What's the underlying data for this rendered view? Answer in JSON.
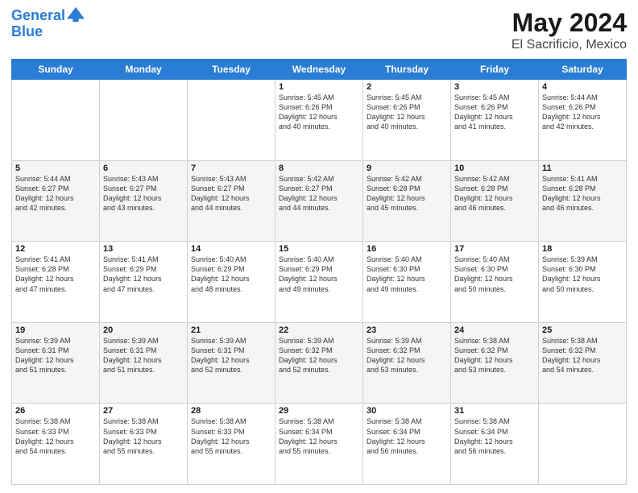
{
  "logo": {
    "line1": "General",
    "line2": "Blue"
  },
  "title": "May 2024",
  "subtitle": "El Sacrificio, Mexico",
  "days_of_week": [
    "Sunday",
    "Monday",
    "Tuesday",
    "Wednesday",
    "Thursday",
    "Friday",
    "Saturday"
  ],
  "weeks": [
    [
      {
        "day": "",
        "info": ""
      },
      {
        "day": "",
        "info": ""
      },
      {
        "day": "",
        "info": ""
      },
      {
        "day": "1",
        "info": "Sunrise: 5:45 AM\nSunset: 6:26 PM\nDaylight: 12 hours\nand 40 minutes."
      },
      {
        "day": "2",
        "info": "Sunrise: 5:45 AM\nSunset: 6:26 PM\nDaylight: 12 hours\nand 40 minutes."
      },
      {
        "day": "3",
        "info": "Sunrise: 5:45 AM\nSunset: 6:26 PM\nDaylight: 12 hours\nand 41 minutes."
      },
      {
        "day": "4",
        "info": "Sunrise: 5:44 AM\nSunset: 6:26 PM\nDaylight: 12 hours\nand 42 minutes."
      }
    ],
    [
      {
        "day": "5",
        "info": "Sunrise: 5:44 AM\nSunset: 6:27 PM\nDaylight: 12 hours\nand 42 minutes."
      },
      {
        "day": "6",
        "info": "Sunrise: 5:43 AM\nSunset: 6:27 PM\nDaylight: 12 hours\nand 43 minutes."
      },
      {
        "day": "7",
        "info": "Sunrise: 5:43 AM\nSunset: 6:27 PM\nDaylight: 12 hours\nand 44 minutes."
      },
      {
        "day": "8",
        "info": "Sunrise: 5:42 AM\nSunset: 6:27 PM\nDaylight: 12 hours\nand 44 minutes."
      },
      {
        "day": "9",
        "info": "Sunrise: 5:42 AM\nSunset: 6:28 PM\nDaylight: 12 hours\nand 45 minutes."
      },
      {
        "day": "10",
        "info": "Sunrise: 5:42 AM\nSunset: 6:28 PM\nDaylight: 12 hours\nand 46 minutes."
      },
      {
        "day": "11",
        "info": "Sunrise: 5:41 AM\nSunset: 6:28 PM\nDaylight: 12 hours\nand 46 minutes."
      }
    ],
    [
      {
        "day": "12",
        "info": "Sunrise: 5:41 AM\nSunset: 6:28 PM\nDaylight: 12 hours\nand 47 minutes."
      },
      {
        "day": "13",
        "info": "Sunrise: 5:41 AM\nSunset: 6:29 PM\nDaylight: 12 hours\nand 47 minutes."
      },
      {
        "day": "14",
        "info": "Sunrise: 5:40 AM\nSunset: 6:29 PM\nDaylight: 12 hours\nand 48 minutes."
      },
      {
        "day": "15",
        "info": "Sunrise: 5:40 AM\nSunset: 6:29 PM\nDaylight: 12 hours\nand 49 minutes."
      },
      {
        "day": "16",
        "info": "Sunrise: 5:40 AM\nSunset: 6:30 PM\nDaylight: 12 hours\nand 49 minutes."
      },
      {
        "day": "17",
        "info": "Sunrise: 5:40 AM\nSunset: 6:30 PM\nDaylight: 12 hours\nand 50 minutes."
      },
      {
        "day": "18",
        "info": "Sunrise: 5:39 AM\nSunset: 6:30 PM\nDaylight: 12 hours\nand 50 minutes."
      }
    ],
    [
      {
        "day": "19",
        "info": "Sunrise: 5:39 AM\nSunset: 6:31 PM\nDaylight: 12 hours\nand 51 minutes."
      },
      {
        "day": "20",
        "info": "Sunrise: 5:39 AM\nSunset: 6:31 PM\nDaylight: 12 hours\nand 51 minutes."
      },
      {
        "day": "21",
        "info": "Sunrise: 5:39 AM\nSunset: 6:31 PM\nDaylight: 12 hours\nand 52 minutes."
      },
      {
        "day": "22",
        "info": "Sunrise: 5:39 AM\nSunset: 6:32 PM\nDaylight: 12 hours\nand 52 minutes."
      },
      {
        "day": "23",
        "info": "Sunrise: 5:39 AM\nSunset: 6:32 PM\nDaylight: 12 hours\nand 53 minutes."
      },
      {
        "day": "24",
        "info": "Sunrise: 5:38 AM\nSunset: 6:32 PM\nDaylight: 12 hours\nand 53 minutes."
      },
      {
        "day": "25",
        "info": "Sunrise: 5:38 AM\nSunset: 6:32 PM\nDaylight: 12 hours\nand 54 minutes."
      }
    ],
    [
      {
        "day": "26",
        "info": "Sunrise: 5:38 AM\nSunset: 6:33 PM\nDaylight: 12 hours\nand 54 minutes."
      },
      {
        "day": "27",
        "info": "Sunrise: 5:38 AM\nSunset: 6:33 PM\nDaylight: 12 hours\nand 55 minutes."
      },
      {
        "day": "28",
        "info": "Sunrise: 5:38 AM\nSunset: 6:33 PM\nDaylight: 12 hours\nand 55 minutes."
      },
      {
        "day": "29",
        "info": "Sunrise: 5:38 AM\nSunset: 6:34 PM\nDaylight: 12 hours\nand 55 minutes."
      },
      {
        "day": "30",
        "info": "Sunrise: 5:38 AM\nSunset: 6:34 PM\nDaylight: 12 hours\nand 56 minutes."
      },
      {
        "day": "31",
        "info": "Sunrise: 5:38 AM\nSunset: 6:34 PM\nDaylight: 12 hours\nand 56 minutes."
      },
      {
        "day": "",
        "info": ""
      }
    ]
  ]
}
